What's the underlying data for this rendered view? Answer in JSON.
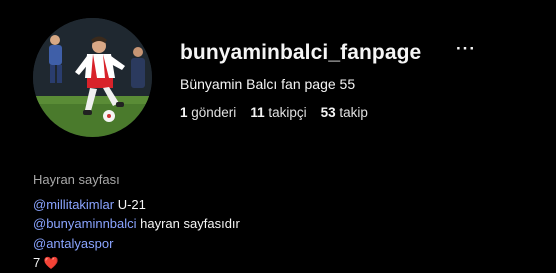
{
  "profile": {
    "username": "bunyaminbalci_fanpage",
    "full_name": "Bünyamin Balcı fan page 55",
    "more_icon": "more-horizontal-icon",
    "avatar_icon": "profile-avatar-photo"
  },
  "stats": [
    {
      "count": "1",
      "label": "gönderi"
    },
    {
      "count": "11",
      "label": "takipçi"
    },
    {
      "count": "53",
      "label": "takip"
    }
  ],
  "bio": {
    "category": "Hayran sayfası",
    "line1": {
      "mention": "@millitakimlar",
      "text": " U-21"
    },
    "line2": {
      "mention": "@bunyaminnbalci",
      "text": " hayran sayfasıdır"
    },
    "line3": {
      "mention": "@antalyaspor"
    },
    "line4": {
      "text": "7 ",
      "emoji": "❤️"
    }
  },
  "colors": {
    "background": "#000000",
    "text": "#f5f5f5",
    "secondary_text": "#a8a8a8",
    "mention": "#8aa4ff",
    "heart": "#e0245e"
  }
}
